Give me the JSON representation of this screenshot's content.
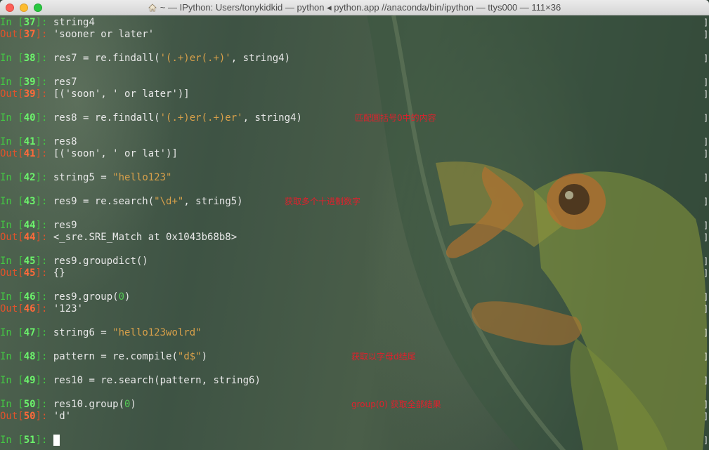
{
  "window": {
    "title": "~ — IPython: Users/tonykidkid — python ◂ python.app //anaconda/bin/ipython — ttys000 — 111×36"
  },
  "icons": {
    "home": "home-icon",
    "close": "close-button",
    "minimize": "minimize-button",
    "zoom": "zoom-button"
  },
  "colors": {
    "in_prompt": "#44c844",
    "out_prompt": "#e0522c",
    "string": "#d8a04a",
    "annotation": "#e0202c"
  },
  "terminal": {
    "lines": [
      {
        "kind": "in",
        "prefix": "In [",
        "num": "37",
        "suffix": "]: ",
        "code": [
          {
            "t": "string4"
          }
        ]
      },
      {
        "kind": "out",
        "prefix": "Out[",
        "num": "37",
        "suffix": "]: ",
        "code": [
          {
            "t": "'sooner or later'"
          }
        ]
      },
      {
        "kind": "blank"
      },
      {
        "kind": "in",
        "prefix": "In [",
        "num": "38",
        "suffix": "]: ",
        "code": [
          {
            "t": "res7 = re.findall("
          },
          {
            "t": "'(.+)er(.+)'",
            "c": "str"
          },
          {
            "t": ", string4)"
          }
        ]
      },
      {
        "kind": "blank"
      },
      {
        "kind": "in",
        "prefix": "In [",
        "num": "39",
        "suffix": "]: ",
        "code": [
          {
            "t": "res7"
          }
        ]
      },
      {
        "kind": "out",
        "prefix": "Out[",
        "num": "39",
        "suffix": "]: ",
        "code": [
          {
            "t": "[('soon', ' or later')]"
          }
        ]
      },
      {
        "kind": "blank"
      },
      {
        "kind": "in",
        "prefix": "In [",
        "num": "40",
        "suffix": "]: ",
        "code": [
          {
            "t": "res8 = re.findall("
          },
          {
            "t": "'(.+)er(.+)er'",
            "c": "str"
          },
          {
            "t": ", string4)"
          }
        ],
        "note": "匹配圆括号0中的内容"
      },
      {
        "kind": "blank"
      },
      {
        "kind": "in",
        "prefix": "In [",
        "num": "41",
        "suffix": "]: ",
        "code": [
          {
            "t": "res8"
          }
        ]
      },
      {
        "kind": "out",
        "prefix": "Out[",
        "num": "41",
        "suffix": "]: ",
        "code": [
          {
            "t": "[('soon', ' or lat')]"
          }
        ]
      },
      {
        "kind": "blank"
      },
      {
        "kind": "in",
        "prefix": "In [",
        "num": "42",
        "suffix": "]: ",
        "code": [
          {
            "t": "string5 = "
          },
          {
            "t": "\"hello123\"",
            "c": "str"
          }
        ]
      },
      {
        "kind": "blank"
      },
      {
        "kind": "in",
        "prefix": "In [",
        "num": "43",
        "suffix": "]: ",
        "code": [
          {
            "t": "res9 = re.search("
          },
          {
            "t": "\"\\d+\"",
            "c": "str"
          },
          {
            "t": ", string5)"
          }
        ],
        "note": "获取多个十进制数字"
      },
      {
        "kind": "blank"
      },
      {
        "kind": "in",
        "prefix": "In [",
        "num": "44",
        "suffix": "]: ",
        "code": [
          {
            "t": "res9"
          }
        ]
      },
      {
        "kind": "out",
        "prefix": "Out[",
        "num": "44",
        "suffix": "]: ",
        "code": [
          {
            "t": "<_sre.SRE_Match at 0x1043b68b8>"
          }
        ]
      },
      {
        "kind": "blank"
      },
      {
        "kind": "in",
        "prefix": "In [",
        "num": "45",
        "suffix": "]: ",
        "code": [
          {
            "t": "res9.groupdict()"
          }
        ]
      },
      {
        "kind": "out",
        "prefix": "Out[",
        "num": "45",
        "suffix": "]: ",
        "code": [
          {
            "t": "{}"
          }
        ]
      },
      {
        "kind": "blank"
      },
      {
        "kind": "in",
        "prefix": "In [",
        "num": "46",
        "suffix": "]: ",
        "code": [
          {
            "t": "res9.group("
          },
          {
            "t": "0",
            "c": "numlit"
          },
          {
            "t": ")"
          }
        ]
      },
      {
        "kind": "out",
        "prefix": "Out[",
        "num": "46",
        "suffix": "]: ",
        "code": [
          {
            "t": "'123'"
          }
        ]
      },
      {
        "kind": "blank"
      },
      {
        "kind": "in",
        "prefix": "In [",
        "num": "47",
        "suffix": "]: ",
        "code": [
          {
            "t": "string6 = "
          },
          {
            "t": "\"hello123wolrd\"",
            "c": "str"
          }
        ]
      },
      {
        "kind": "blank"
      },
      {
        "kind": "in",
        "prefix": "In [",
        "num": "48",
        "suffix": "]: ",
        "code": [
          {
            "t": "pattern = re.compile("
          },
          {
            "t": "\"d$\"",
            "c": "str"
          },
          {
            "t": ")"
          }
        ],
        "note": "获取以字母d结尾"
      },
      {
        "kind": "blank"
      },
      {
        "kind": "in",
        "prefix": "In [",
        "num": "49",
        "suffix": "]: ",
        "code": [
          {
            "t": "res10 = re.search(pattern, string6)"
          }
        ]
      },
      {
        "kind": "blank"
      },
      {
        "kind": "in",
        "prefix": "In [",
        "num": "50",
        "suffix": "]: ",
        "code": [
          {
            "t": "res10.group("
          },
          {
            "t": "0",
            "c": "numlit"
          },
          {
            "t": ")"
          }
        ],
        "note": "group(0) 获取全部结果"
      },
      {
        "kind": "out",
        "prefix": "Out[",
        "num": "50",
        "suffix": "]: ",
        "code": [
          {
            "t": "'d'"
          }
        ]
      },
      {
        "kind": "blank"
      },
      {
        "kind": "in",
        "prefix": "In [",
        "num": "51",
        "suffix": "]: ",
        "code": [],
        "cursor": true
      }
    ]
  }
}
